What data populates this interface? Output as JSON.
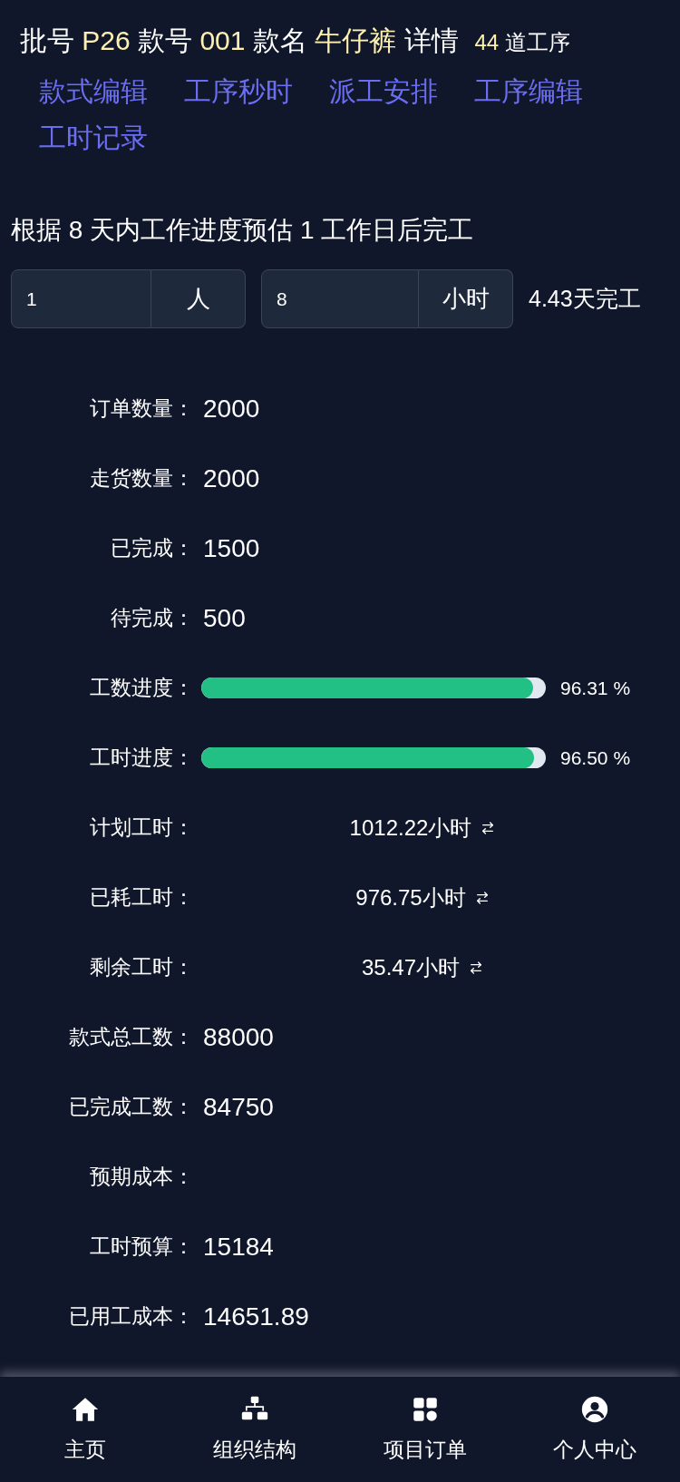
{
  "header": {
    "parts": [
      {
        "text": "批号",
        "highlight": false
      },
      {
        "text": "P26",
        "highlight": true
      },
      {
        "text": "款号",
        "highlight": false
      },
      {
        "text": "001",
        "highlight": true
      },
      {
        "text": "款名",
        "highlight": false
      },
      {
        "text": "牛仔裤",
        "highlight": true
      },
      {
        "text": "详情",
        "highlight": false
      }
    ],
    "count": "44",
    "count_label": "道工序"
  },
  "links": [
    "款式编辑",
    "工序秒时",
    "派工安排",
    "工序编辑",
    "工时记录"
  ],
  "estimate": "根据 8 天内工作进度预估 1 工作日后完工",
  "calculator": {
    "people": {
      "value": "1",
      "unit": "人"
    },
    "hours": {
      "value": "8",
      "unit": "小时"
    },
    "result": "4.43天完工"
  },
  "rows": [
    {
      "kind": "text",
      "label": "订单数量：",
      "value": "2000"
    },
    {
      "kind": "text",
      "label": "走货数量：",
      "value": "2000"
    },
    {
      "kind": "text",
      "label": "已完成：",
      "value": "1500"
    },
    {
      "kind": "text",
      "label": "待完成：",
      "value": "500"
    },
    {
      "kind": "progress",
      "label": "工数进度：",
      "level": 0.9631,
      "reading": "96.31 %"
    },
    {
      "kind": "progress",
      "label": "工时进度：",
      "level": 0.965,
      "reading": "96.50 %"
    },
    {
      "kind": "hours",
      "label": "计划工时：",
      "value": "1012.22小时"
    },
    {
      "kind": "hours",
      "label": "已耗工时：",
      "value": "976.75小时"
    },
    {
      "kind": "hours",
      "label": "剩余工时：",
      "value": "35.47小时"
    },
    {
      "kind": "text",
      "label": "款式总工数：",
      "value": "88000"
    },
    {
      "kind": "text",
      "label": "已完成工数：",
      "value": "84750"
    },
    {
      "kind": "text",
      "label": "预期成本："
    },
    {
      "kind": "text",
      "label": "工时预算：",
      "value": "15184"
    },
    {
      "kind": "text",
      "label": "已用工成本：",
      "value": "14651.89"
    }
  ],
  "nav": [
    {
      "kind": "home",
      "label": "主页"
    },
    {
      "kind": "org",
      "label": "组织结构"
    },
    {
      "kind": "grid",
      "label": "项目订单"
    },
    {
      "kind": "user",
      "label": "个人中心"
    }
  ]
}
